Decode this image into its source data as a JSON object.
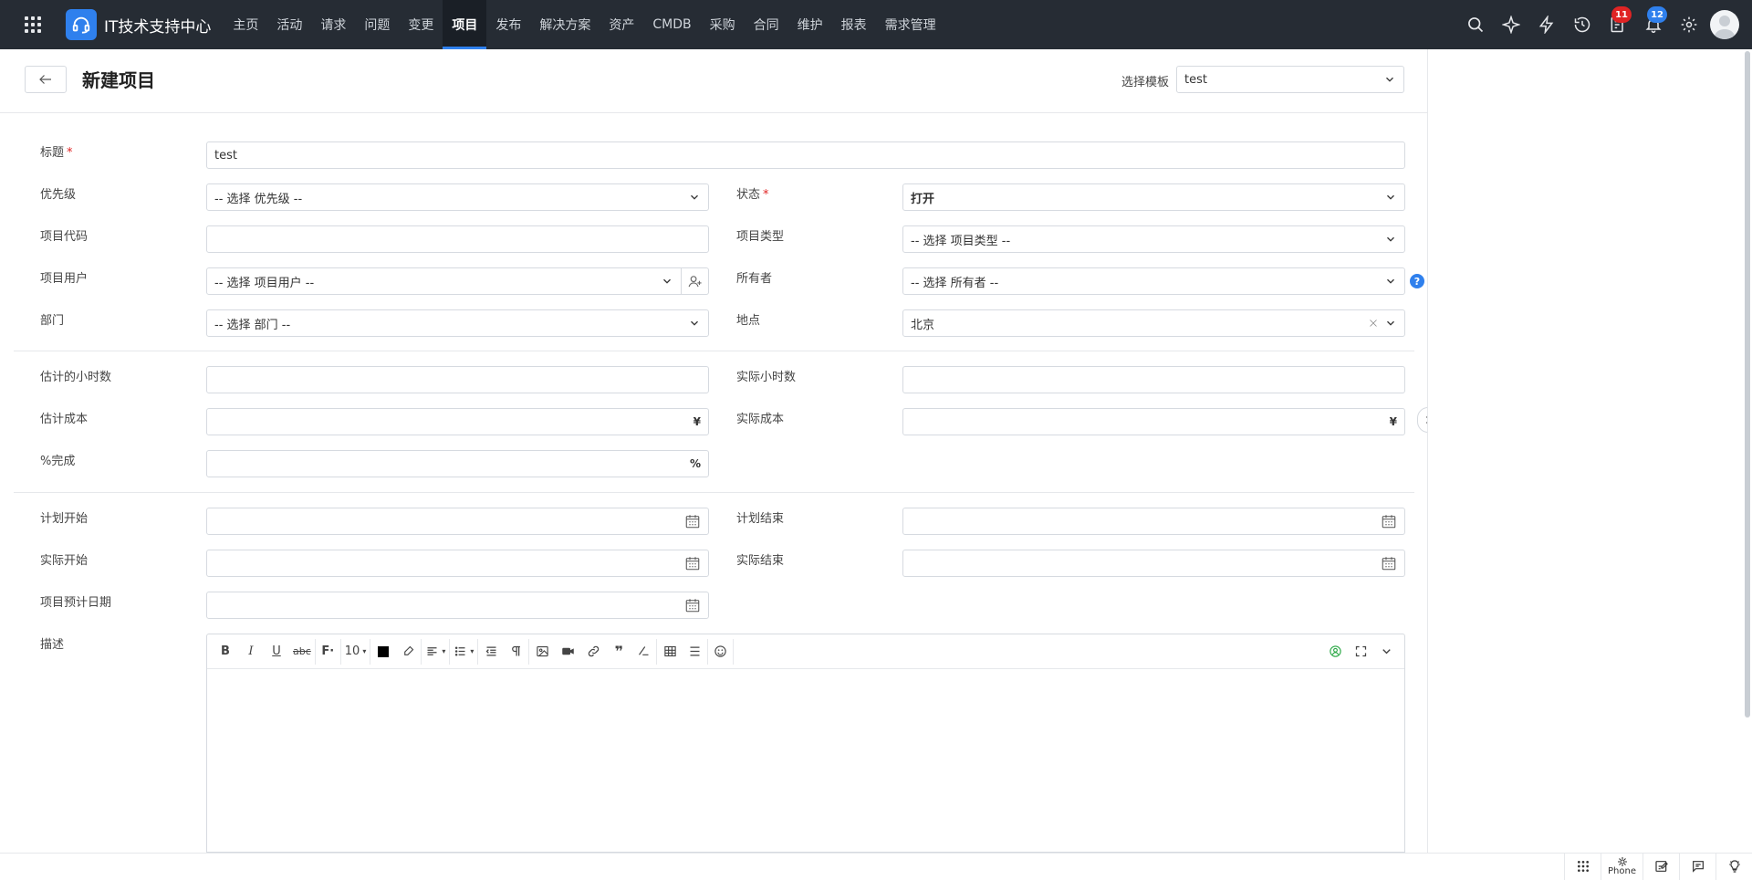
{
  "app": {
    "title": "IT技术支持中心",
    "nav": [
      "主页",
      "活动",
      "请求",
      "问题",
      "变更",
      "项目",
      "发布",
      "解决方案",
      "资产",
      "CMDB",
      "采购",
      "合同",
      "维护",
      "报表",
      "需求管理"
    ],
    "active_nav": "项目",
    "badges": {
      "tasks": "11",
      "notifications": "12"
    }
  },
  "header": {
    "title": "新建项目",
    "template_label": "选择模板",
    "template_value": "test"
  },
  "form": {
    "title_label": "标题",
    "title_value": "test",
    "priority_label": "优先级",
    "priority_value": "-- 选择 优先级 --",
    "status_label": "状态",
    "status_value": "打开",
    "code_label": "项目代码",
    "code_value": "",
    "type_label": "项目类型",
    "type_value": "-- 选择 项目类型 --",
    "users_label": "项目用户",
    "users_value": "-- 选择 项目用户 --",
    "owner_label": "所有者",
    "owner_value": "-- 选择 所有者 --",
    "help": "?",
    "dept_label": "部门",
    "dept_value": "-- 选择 部门 --",
    "site_label": "地点",
    "site_value": "北京",
    "est_hours_label": "估计的小时数",
    "actual_hours_label": "实际小时数",
    "est_cost_label": "估计成本",
    "actual_cost_label": "实际成本",
    "currency": "¥",
    "percent_label": "%完成",
    "percent_suffix": "%",
    "plan_start_label": "计划开始",
    "plan_end_label": "计划结束",
    "actual_start_label": "实际开始",
    "actual_end_label": "实际结束",
    "due_label": "项目预计日期",
    "desc_label": "描述"
  },
  "editor": {
    "font_size": "10"
  },
  "bottom": {
    "phone_label": "Phone"
  }
}
